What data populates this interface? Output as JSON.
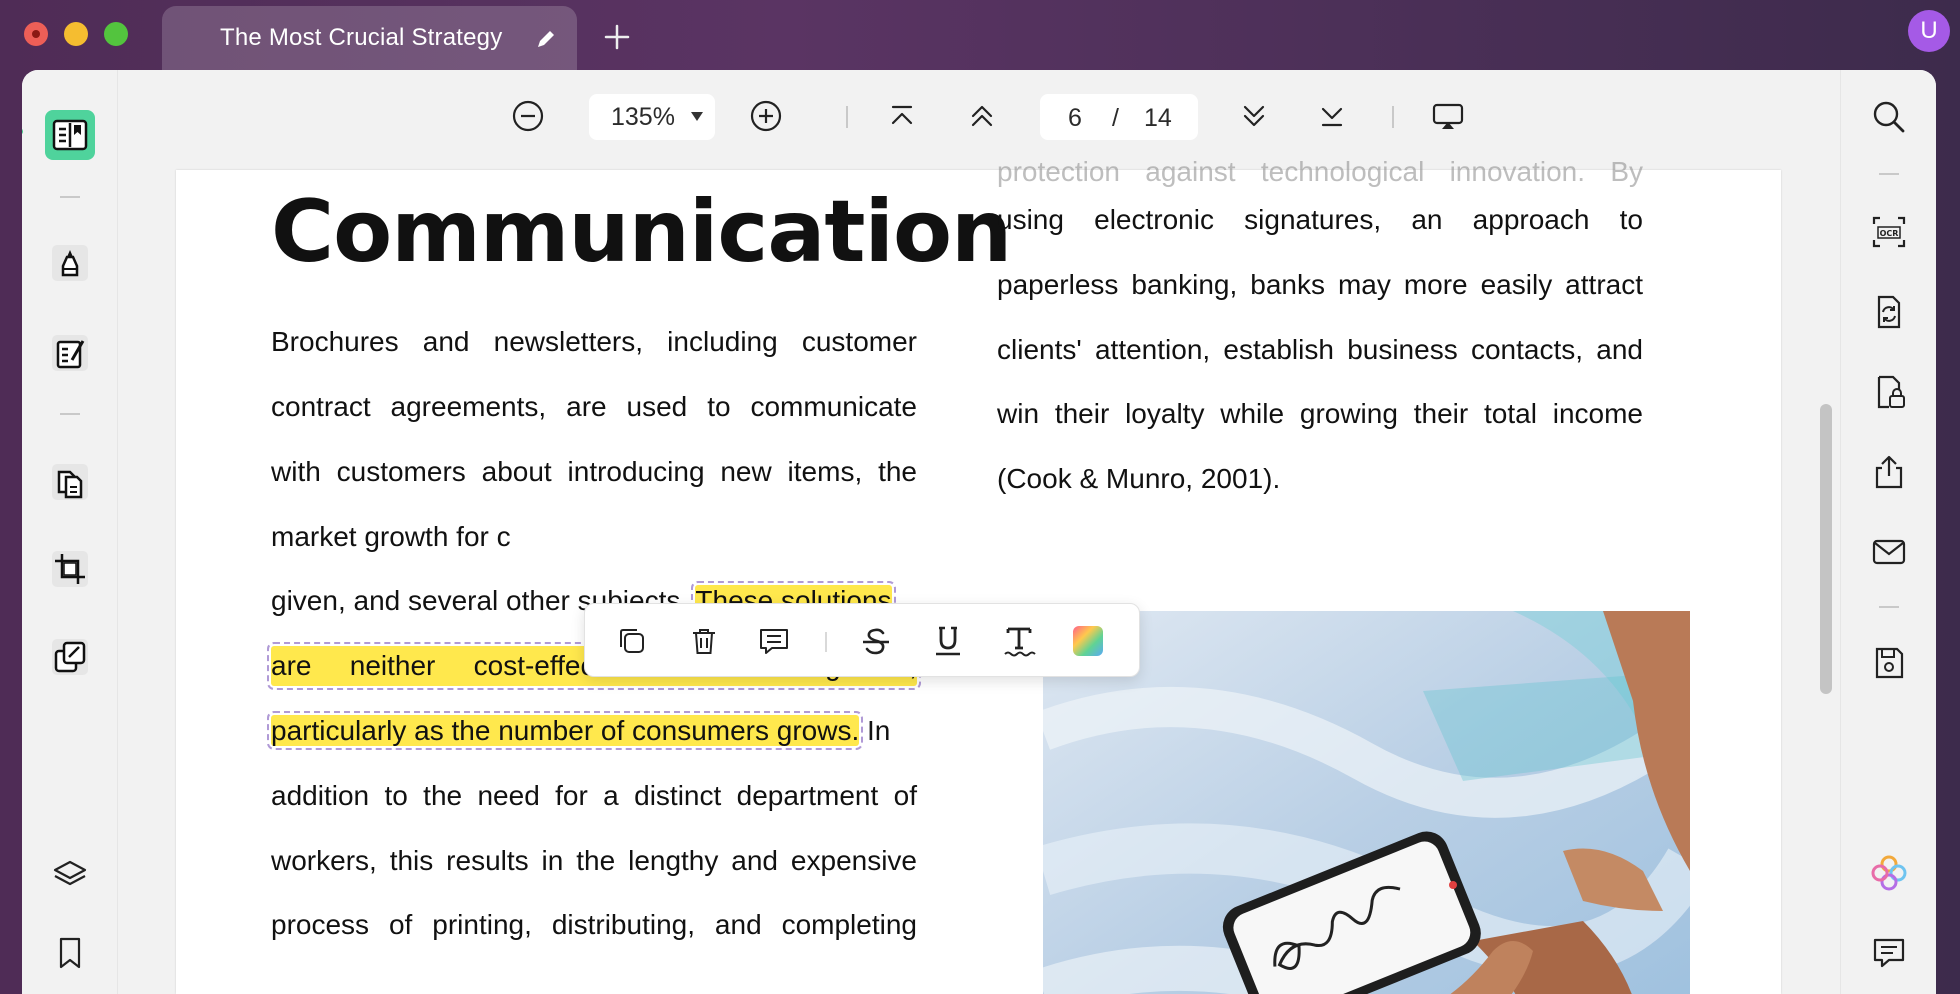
{
  "titlebar": {
    "tab_title": "The Most Crucial Strategy",
    "user_initial": "U"
  },
  "toolbar": {
    "zoom": "135%",
    "page_current": "6",
    "page_separator": "/",
    "page_total": "14"
  },
  "left_sidebar": {
    "items": [
      "reader",
      "comment",
      "edit",
      "organize-pages",
      "crop",
      "batch"
    ],
    "bottom": [
      "layers",
      "bookmark"
    ]
  },
  "right_sidebar": {
    "items": [
      "search",
      "ocr",
      "convert",
      "protect",
      "share",
      "email",
      "save",
      "ai-assistant",
      "comments"
    ]
  },
  "document": {
    "heading": "Communication",
    "left_column": {
      "l1": "Brochures and newsletters, including customer",
      "l2": "contract agreements, are used to communicate",
      "l3": "with customers about introducing new items, the",
      "l4": "market growth for c",
      "l5_plain": "given, and several other subjects. ",
      "l5_highlight": "These solutions",
      "l6_highlight": "are neither cost-effective nor manageable,",
      "l7_highlight": "particularly as the number of consumers grows.",
      "l7_plain": " In",
      "l8": "addition to the need for a distinct department of",
      "l9": "workers, this results in the lengthy and expensive",
      "l10": "process of printing, distributing, and completing"
    },
    "right_column": {
      "l0": "protection against technological innovation. By",
      "l1": "using electronic signatures, an approach to",
      "l2": "paperless banking, banks may more easily attract",
      "l3": "clients' attention, establish business contacts, and",
      "l4": "win their loyalty while growing their total income",
      "l5": "(Cook & Munro, 2001)."
    }
  },
  "highlight_popup": {
    "tools": [
      "copy",
      "delete",
      "comment",
      "strikethrough",
      "underline",
      "squiggly",
      "color"
    ]
  },
  "colors": {
    "highlight": "#ffe84d",
    "accent_green": "#4fd39c",
    "avatar_purple": "#a55ae6"
  }
}
